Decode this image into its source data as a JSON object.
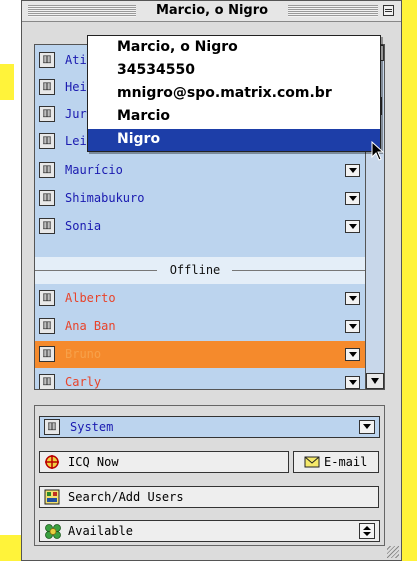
{
  "window": {
    "title": "Marcio, o Nigro"
  },
  "popup": {
    "items": [
      {
        "label": "Marcio, o Nigro"
      },
      {
        "label": "34534550"
      },
      {
        "label": "mnigro@spo.matrix.com.br"
      },
      {
        "label": "Marcio"
      },
      {
        "label": "Nigro"
      }
    ],
    "highlighted_index": 4
  },
  "contacts": {
    "online": [
      {
        "name": "Ati"
      },
      {
        "name": "Hei"
      },
      {
        "name": "Jur"
      },
      {
        "name": "Lei"
      },
      {
        "name": "Maurício"
      },
      {
        "name": "Shimabukuro"
      },
      {
        "name": "Sonia"
      }
    ],
    "offline_label": "Offline",
    "offline": [
      {
        "name": "Alberto"
      },
      {
        "name": "Ana Ban"
      },
      {
        "name": "Bruno"
      },
      {
        "name": "Carly"
      }
    ],
    "selected": "Bruno"
  },
  "panel": {
    "system": {
      "name": "System"
    },
    "icq_now": {
      "label": "ICQ Now"
    },
    "email": {
      "label": "E-mail"
    },
    "search": {
      "label": "Search/Add Users"
    },
    "status": {
      "value": "Available"
    }
  },
  "colors": {
    "list_bg": "#bcd4ee",
    "online_name": "#1a1ab0",
    "offline_name": "#e8432a",
    "selected_row": "#f58a2c",
    "popup_highlight": "#1d3ea8",
    "page_accent": "#fff33a"
  },
  "icons": {
    "contact": "contact-card-icon",
    "icq_now": "icq-flower-icon",
    "email": "envelope-icon",
    "search": "search-users-icon",
    "status": "status-flower-icon"
  }
}
